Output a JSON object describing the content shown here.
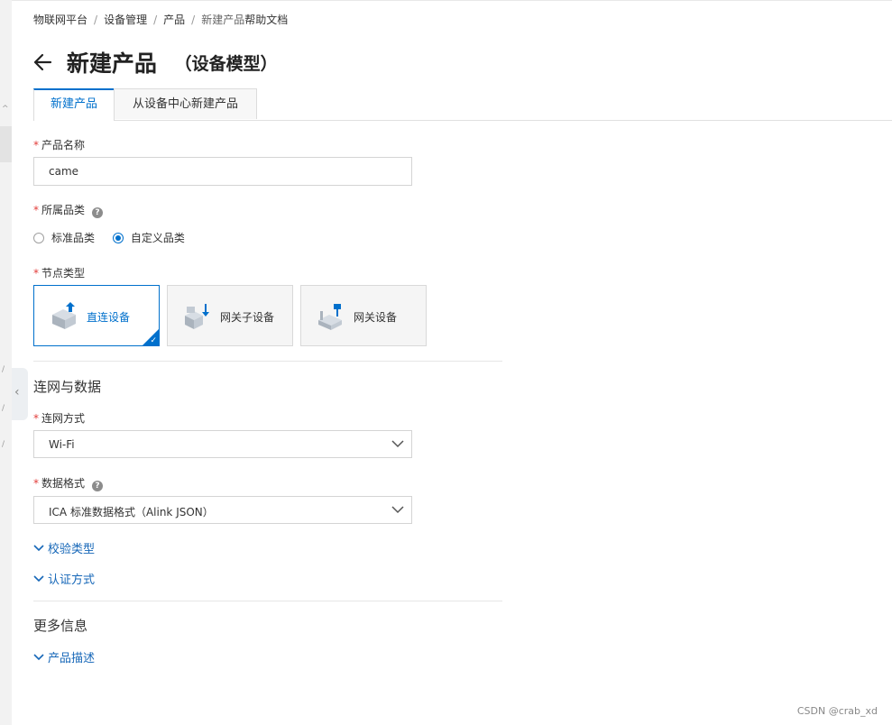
{
  "breadcrumb": {
    "items": [
      "物联网平台",
      "设备管理",
      "产品",
      "新建产品"
    ],
    "separator": "/",
    "help_link": "帮助文档"
  },
  "header": {
    "title": "新建产品",
    "subtitle": "（设备模型）"
  },
  "tabs": [
    {
      "label": "新建产品",
      "active": true
    },
    {
      "label": "从设备中心新建产品",
      "active": false
    }
  ],
  "form": {
    "required_mark": "*",
    "product_name": {
      "label": "产品名称",
      "value": "came"
    },
    "category": {
      "label": "所属品类",
      "help_icon": "question-circle-icon",
      "options": [
        {
          "label": "标准品类",
          "checked": false
        },
        {
          "label": "自定义品类",
          "checked": true
        }
      ]
    },
    "node_type": {
      "label": "节点类型",
      "cards": [
        {
          "label": "直连设备",
          "icon": "direct-device-icon",
          "selected": true
        },
        {
          "label": "网关子设备",
          "icon": "gateway-subdevice-icon",
          "selected": false
        },
        {
          "label": "网关设备",
          "icon": "gateway-device-icon",
          "selected": false
        }
      ]
    },
    "network_section": {
      "title": "连网与数据",
      "network_method": {
        "label": "连网方式",
        "value": "Wi-Fi"
      },
      "data_format": {
        "label": "数据格式",
        "help_icon": "question-circle-icon",
        "value": "ICA 标准数据格式（Alink JSON）"
      },
      "verify_type": "校验类型",
      "auth_method": "认证方式"
    },
    "more_section": {
      "title": "更多信息",
      "product_description": "产品描述"
    }
  },
  "watermark": "CSDN @crab_xd",
  "colors": {
    "accent": "#0070cc",
    "link": "#1667b8",
    "required": "#e23c39",
    "border": "#d4d4d4",
    "card_bg": "#f5f5f5"
  }
}
